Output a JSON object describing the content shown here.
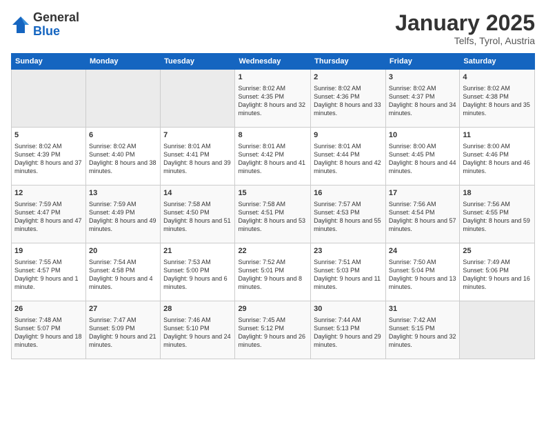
{
  "logo": {
    "general": "General",
    "blue": "Blue"
  },
  "title": "January 2025",
  "subtitle": "Telfs, Tyrol, Austria",
  "days_of_week": [
    "Sunday",
    "Monday",
    "Tuesday",
    "Wednesday",
    "Thursday",
    "Friday",
    "Saturday"
  ],
  "weeks": [
    [
      {
        "day": "",
        "empty": true
      },
      {
        "day": "",
        "empty": true
      },
      {
        "day": "",
        "empty": true
      },
      {
        "day": "1",
        "lines": [
          "Sunrise: 8:02 AM",
          "Sunset: 4:35 PM",
          "Daylight: 8 hours and 32 minutes."
        ]
      },
      {
        "day": "2",
        "lines": [
          "Sunrise: 8:02 AM",
          "Sunset: 4:36 PM",
          "Daylight: 8 hours and 33 minutes."
        ]
      },
      {
        "day": "3",
        "lines": [
          "Sunrise: 8:02 AM",
          "Sunset: 4:37 PM",
          "Daylight: 8 hours and 34 minutes."
        ]
      },
      {
        "day": "4",
        "lines": [
          "Sunrise: 8:02 AM",
          "Sunset: 4:38 PM",
          "Daylight: 8 hours and 35 minutes."
        ]
      }
    ],
    [
      {
        "day": "5",
        "lines": [
          "Sunrise: 8:02 AM",
          "Sunset: 4:39 PM",
          "Daylight: 8 hours and 37 minutes."
        ]
      },
      {
        "day": "6",
        "lines": [
          "Sunrise: 8:02 AM",
          "Sunset: 4:40 PM",
          "Daylight: 8 hours and 38 minutes."
        ]
      },
      {
        "day": "7",
        "lines": [
          "Sunrise: 8:01 AM",
          "Sunset: 4:41 PM",
          "Daylight: 8 hours and 39 minutes."
        ]
      },
      {
        "day": "8",
        "lines": [
          "Sunrise: 8:01 AM",
          "Sunset: 4:42 PM",
          "Daylight: 8 hours and 41 minutes."
        ]
      },
      {
        "day": "9",
        "lines": [
          "Sunrise: 8:01 AM",
          "Sunset: 4:44 PM",
          "Daylight: 8 hours and 42 minutes."
        ]
      },
      {
        "day": "10",
        "lines": [
          "Sunrise: 8:00 AM",
          "Sunset: 4:45 PM",
          "Daylight: 8 hours and 44 minutes."
        ]
      },
      {
        "day": "11",
        "lines": [
          "Sunrise: 8:00 AM",
          "Sunset: 4:46 PM",
          "Daylight: 8 hours and 46 minutes."
        ]
      }
    ],
    [
      {
        "day": "12",
        "lines": [
          "Sunrise: 7:59 AM",
          "Sunset: 4:47 PM",
          "Daylight: 8 hours and 47 minutes."
        ]
      },
      {
        "day": "13",
        "lines": [
          "Sunrise: 7:59 AM",
          "Sunset: 4:49 PM",
          "Daylight: 8 hours and 49 minutes."
        ]
      },
      {
        "day": "14",
        "lines": [
          "Sunrise: 7:58 AM",
          "Sunset: 4:50 PM",
          "Daylight: 8 hours and 51 minutes."
        ]
      },
      {
        "day": "15",
        "lines": [
          "Sunrise: 7:58 AM",
          "Sunset: 4:51 PM",
          "Daylight: 8 hours and 53 minutes."
        ]
      },
      {
        "day": "16",
        "lines": [
          "Sunrise: 7:57 AM",
          "Sunset: 4:53 PM",
          "Daylight: 8 hours and 55 minutes."
        ]
      },
      {
        "day": "17",
        "lines": [
          "Sunrise: 7:56 AM",
          "Sunset: 4:54 PM",
          "Daylight: 8 hours and 57 minutes."
        ]
      },
      {
        "day": "18",
        "lines": [
          "Sunrise: 7:56 AM",
          "Sunset: 4:55 PM",
          "Daylight: 8 hours and 59 minutes."
        ]
      }
    ],
    [
      {
        "day": "19",
        "lines": [
          "Sunrise: 7:55 AM",
          "Sunset: 4:57 PM",
          "Daylight: 9 hours and 1 minute."
        ]
      },
      {
        "day": "20",
        "lines": [
          "Sunrise: 7:54 AM",
          "Sunset: 4:58 PM",
          "Daylight: 9 hours and 4 minutes."
        ]
      },
      {
        "day": "21",
        "lines": [
          "Sunrise: 7:53 AM",
          "Sunset: 5:00 PM",
          "Daylight: 9 hours and 6 minutes."
        ]
      },
      {
        "day": "22",
        "lines": [
          "Sunrise: 7:52 AM",
          "Sunset: 5:01 PM",
          "Daylight: 9 hours and 8 minutes."
        ]
      },
      {
        "day": "23",
        "lines": [
          "Sunrise: 7:51 AM",
          "Sunset: 5:03 PM",
          "Daylight: 9 hours and 11 minutes."
        ]
      },
      {
        "day": "24",
        "lines": [
          "Sunrise: 7:50 AM",
          "Sunset: 5:04 PM",
          "Daylight: 9 hours and 13 minutes."
        ]
      },
      {
        "day": "25",
        "lines": [
          "Sunrise: 7:49 AM",
          "Sunset: 5:06 PM",
          "Daylight: 9 hours and 16 minutes."
        ]
      }
    ],
    [
      {
        "day": "26",
        "lines": [
          "Sunrise: 7:48 AM",
          "Sunset: 5:07 PM",
          "Daylight: 9 hours and 18 minutes."
        ]
      },
      {
        "day": "27",
        "lines": [
          "Sunrise: 7:47 AM",
          "Sunset: 5:09 PM",
          "Daylight: 9 hours and 21 minutes."
        ]
      },
      {
        "day": "28",
        "lines": [
          "Sunrise: 7:46 AM",
          "Sunset: 5:10 PM",
          "Daylight: 9 hours and 24 minutes."
        ]
      },
      {
        "day": "29",
        "lines": [
          "Sunrise: 7:45 AM",
          "Sunset: 5:12 PM",
          "Daylight: 9 hours and 26 minutes."
        ]
      },
      {
        "day": "30",
        "lines": [
          "Sunrise: 7:44 AM",
          "Sunset: 5:13 PM",
          "Daylight: 9 hours and 29 minutes."
        ]
      },
      {
        "day": "31",
        "lines": [
          "Sunrise: 7:42 AM",
          "Sunset: 5:15 PM",
          "Daylight: 9 hours and 32 minutes."
        ]
      },
      {
        "day": "",
        "empty": true
      }
    ]
  ]
}
